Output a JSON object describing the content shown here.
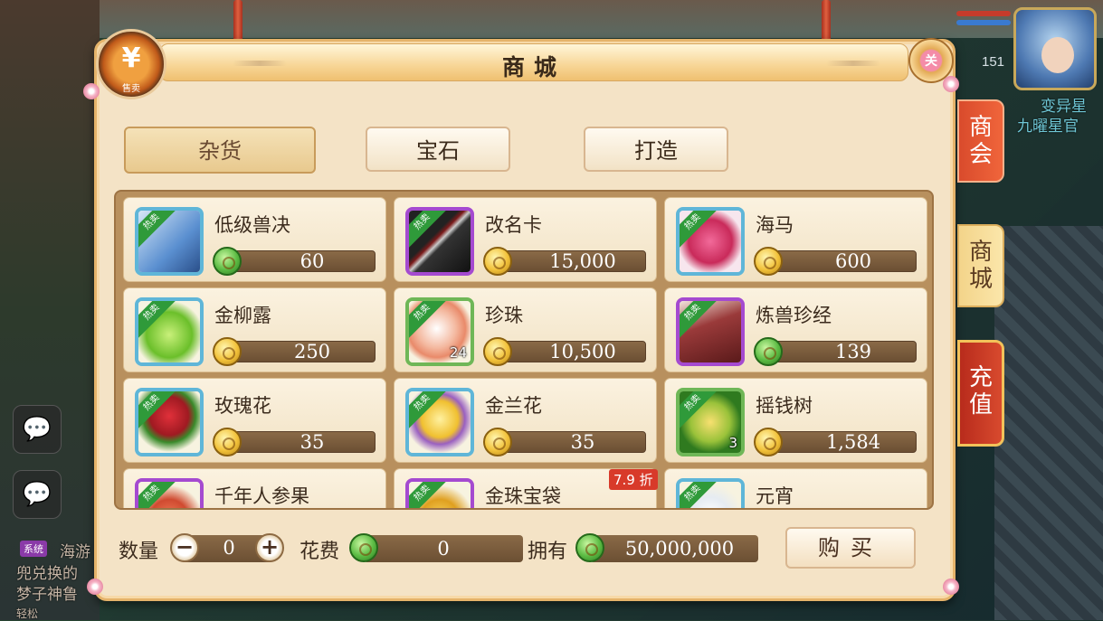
{
  "window": {
    "title": "商城"
  },
  "hud": {
    "level": "151",
    "player_name": "变异星",
    "player_title": "九曜星官"
  },
  "chat": {
    "line1": "海游",
    "line2": "兜兑换的",
    "line3": "梦子神鲁",
    "system_tag": "系统",
    "bottom_left": "轻松"
  },
  "panel": {
    "sell_label": "售卖",
    "sell_symbol": "¥",
    "close_label": "关"
  },
  "tabs": [
    {
      "label": "杂货",
      "active": true
    },
    {
      "label": "宝石",
      "active": false
    },
    {
      "label": "打造",
      "active": false
    }
  ],
  "side_tabs": [
    {
      "label": "商会"
    },
    {
      "label": "商城"
    },
    {
      "label": "充值"
    }
  ],
  "hot_label": "热卖",
  "items": [
    {
      "name": "低级兽决",
      "price": "60",
      "currency": "jade",
      "frame": "blue",
      "icon": "book-icon",
      "count": ""
    },
    {
      "name": "改名卡",
      "price": "15,000",
      "currency": "gold",
      "frame": "purple",
      "icon": "sword-icon",
      "count": ""
    },
    {
      "name": "海马",
      "price": "600",
      "currency": "gold",
      "frame": "blue",
      "icon": "seahorse-icon",
      "count": ""
    },
    {
      "name": "金柳露",
      "price": "250",
      "currency": "gold",
      "frame": "blue",
      "icon": "bottle-icon",
      "count": ""
    },
    {
      "name": "珍珠",
      "price": "10,500",
      "currency": "gold",
      "frame": "green",
      "icon": "pearl-icon",
      "count": "24"
    },
    {
      "name": "炼兽珍经",
      "price": "139",
      "currency": "jade",
      "frame": "purple",
      "icon": "scripture-icon",
      "count": ""
    },
    {
      "name": "玫瑰花",
      "price": "35",
      "currency": "gold",
      "frame": "blue",
      "icon": "rose-icon",
      "count": ""
    },
    {
      "name": "金兰花",
      "price": "35",
      "currency": "gold",
      "frame": "blue",
      "icon": "orchid-icon",
      "count": ""
    },
    {
      "name": "摇钱树",
      "price": "1,584",
      "currency": "gold",
      "frame": "green",
      "icon": "money-tree-icon",
      "count": "3"
    },
    {
      "name": "千年人参果",
      "price": "",
      "currency": "gold",
      "frame": "purple",
      "icon": "ginseng-fruit-icon",
      "count": ""
    },
    {
      "name": "金珠宝袋",
      "price": "",
      "currency": "gold",
      "frame": "purple",
      "icon": "treasure-bag-icon",
      "count": ""
    },
    {
      "name": "元宵",
      "price": "",
      "currency": "gold",
      "frame": "blue",
      "icon": "dumpling-icon",
      "count": ""
    }
  ],
  "discount_badge": "7.9 折",
  "bottom": {
    "quantity_label": "数量",
    "quantity_value": "0",
    "minus": "−",
    "plus": "+",
    "cost_label": "花费",
    "cost_value": "0",
    "owned_label": "拥有",
    "owned_value": "50,000,000",
    "buy_label": "购买"
  },
  "colors": {
    "panel_bg": "#f4e3c6",
    "price_bar": "#6b4f33",
    "side_tab_red": "#e55a34",
    "hot_ribbon": "#2f9a3a",
    "discount": "#d83a2a"
  }
}
